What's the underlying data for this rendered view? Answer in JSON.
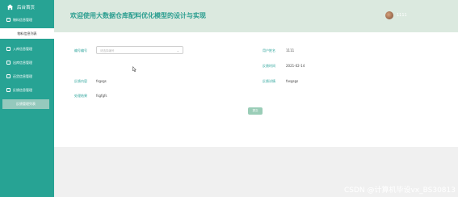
{
  "sidebar": {
    "home_label": "后台首页",
    "items": [
      {
        "label": "物料信息管理"
      },
      {
        "label": "物料信息列表"
      },
      {
        "label": "入库信息管理"
      },
      {
        "label": "出库信息管理"
      },
      {
        "label": "还货信息管理"
      },
      {
        "label": "反馈信息管理"
      },
      {
        "label": "反馈管理列表"
      }
    ]
  },
  "header": {
    "title": "欢迎使用大数据仓库配料优化模型的设计与实现",
    "username": "1111"
  },
  "form": {
    "order_label": "编号编号",
    "order_placeholder": "请选择编号",
    "user_label": "用户姓名",
    "user_value": "1111",
    "feedback_time_label": "反馈时间",
    "feedback_time_value": "2021-02-14",
    "content_label": "反馈内容",
    "content_value": "fsgsgs",
    "evaluation_label": "反馈详情",
    "evaluation_value": "fasgsgs",
    "result_label": "处理结果",
    "result_value": "fsgfgfs",
    "submit_label": "提交"
  },
  "watermark": "CSDN @计算机毕设vx_BS30813"
}
